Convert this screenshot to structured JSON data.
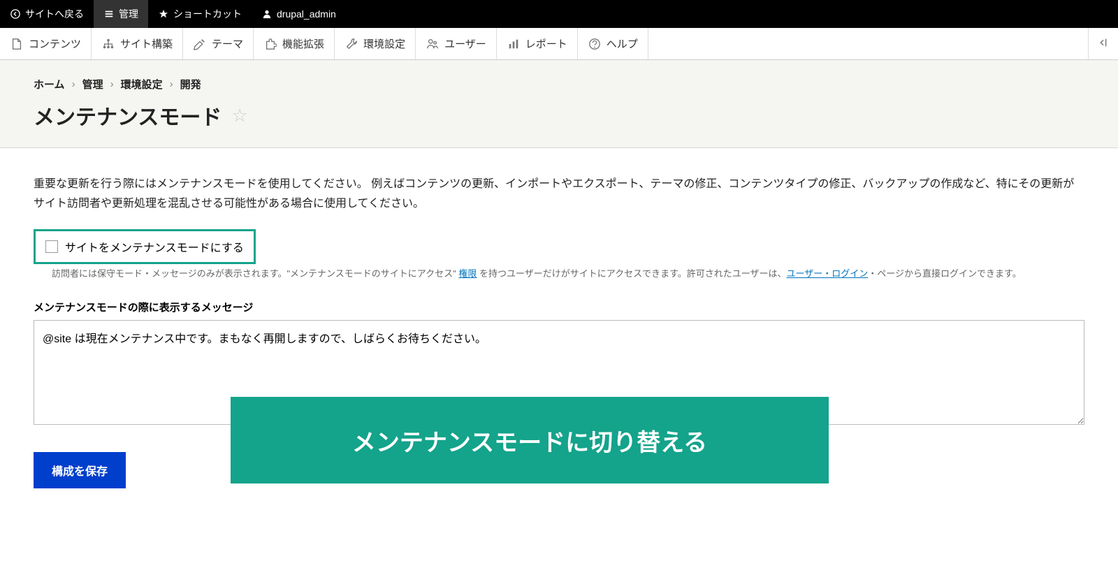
{
  "top_toolbar": {
    "back_to_site": "サイトへ戻る",
    "manage": "管理",
    "shortcuts": "ショートカット",
    "user": "drupal_admin"
  },
  "admin_menu": {
    "content": "コンテンツ",
    "structure": "サイト構築",
    "appearance": "テーマ",
    "extend": "機能拡張",
    "configuration": "環境設定",
    "people": "ユーザー",
    "reports": "レポート",
    "help": "ヘルプ"
  },
  "breadcrumb": {
    "home": "ホーム",
    "admin": "管理",
    "config": "環境設定",
    "dev": "開発"
  },
  "page_title": "メンテナンスモード",
  "description": "重要な更新を行う際にはメンテナンスモードを使用してください。 例えばコンテンツの更新、インポートやエクスポート、テーマの修正、コンテンツタイプの修正、バックアップの作成など、特にその更新がサイト訪問者や更新処理を混乱させる可能性がある場合に使用してください。",
  "checkbox_label": "サイトをメンテナンスモードにする",
  "help_text": {
    "part1": "訪問者には保守モード・メッセージのみが表示されます。\"メンテナンスモードのサイトにアクセス\" ",
    "link1": "権限",
    "part2": " を持つユーザーだけがサイトにアクセスできます。許可されたユーザーは、",
    "link2": "ユーザー・ログイン",
    "part3": "・ページから直接ログインできます。"
  },
  "message_label": "メンテナンスモードの際に表示するメッセージ",
  "message_value": "@site は現在メンテナンス中です。まもなく再開しますので、しばらくお待ちください。",
  "save_button": "構成を保存",
  "overlay_text": "メンテナンスモードに切り替える"
}
